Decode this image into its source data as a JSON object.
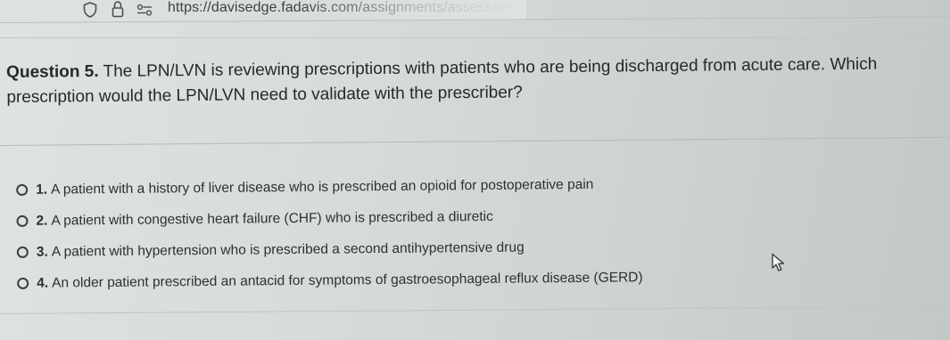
{
  "address_bar": {
    "url": "https://davisedge.fadavis.com/assignments/assessment"
  },
  "question": {
    "number_label": "Question 5.",
    "text": "The LPN/LVN is reviewing prescriptions with patients who are being discharged from acute care. Which prescription would the LPN/LVN need to validate with the prescriber?"
  },
  "options": [
    {
      "number": "1.",
      "text": "A patient with a history of liver disease who is prescribed an opioid for postoperative pain"
    },
    {
      "number": "2.",
      "text": "A patient with congestive heart failure (CHF) who is prescribed a diuretic"
    },
    {
      "number": "3.",
      "text": "A patient with hypertension who is prescribed a second antihypertensive drug"
    },
    {
      "number": "4.",
      "text": "An older patient prescribed an antacid for symptoms of gastroesophageal reflux disease (GERD)"
    }
  ],
  "icons": {
    "shield": "shield-icon",
    "lock": "lock-icon",
    "tune": "tune-icon",
    "cursor": "mouse-pointer-icon"
  }
}
